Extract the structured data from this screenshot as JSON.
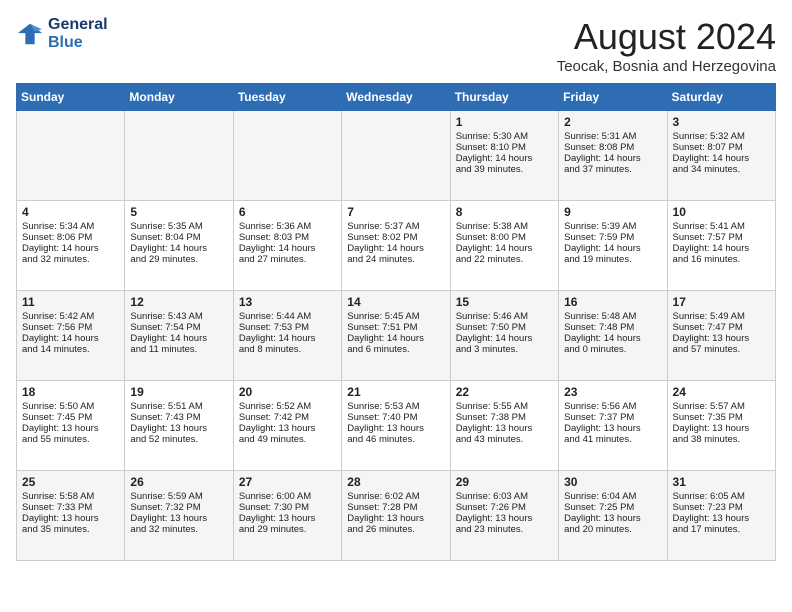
{
  "logo": {
    "line1": "General",
    "line2": "Blue"
  },
  "title": "August 2024",
  "location": "Teocak, Bosnia and Herzegovina",
  "headers": [
    "Sunday",
    "Monday",
    "Tuesday",
    "Wednesday",
    "Thursday",
    "Friday",
    "Saturday"
  ],
  "weeks": [
    [
      {
        "day": "",
        "content": ""
      },
      {
        "day": "",
        "content": ""
      },
      {
        "day": "",
        "content": ""
      },
      {
        "day": "",
        "content": ""
      },
      {
        "day": "1",
        "content": "Sunrise: 5:30 AM\nSunset: 8:10 PM\nDaylight: 14 hours\nand 39 minutes."
      },
      {
        "day": "2",
        "content": "Sunrise: 5:31 AM\nSunset: 8:08 PM\nDaylight: 14 hours\nand 37 minutes."
      },
      {
        "day": "3",
        "content": "Sunrise: 5:32 AM\nSunset: 8:07 PM\nDaylight: 14 hours\nand 34 minutes."
      }
    ],
    [
      {
        "day": "4",
        "content": "Sunrise: 5:34 AM\nSunset: 8:06 PM\nDaylight: 14 hours\nand 32 minutes."
      },
      {
        "day": "5",
        "content": "Sunrise: 5:35 AM\nSunset: 8:04 PM\nDaylight: 14 hours\nand 29 minutes."
      },
      {
        "day": "6",
        "content": "Sunrise: 5:36 AM\nSunset: 8:03 PM\nDaylight: 14 hours\nand 27 minutes."
      },
      {
        "day": "7",
        "content": "Sunrise: 5:37 AM\nSunset: 8:02 PM\nDaylight: 14 hours\nand 24 minutes."
      },
      {
        "day": "8",
        "content": "Sunrise: 5:38 AM\nSunset: 8:00 PM\nDaylight: 14 hours\nand 22 minutes."
      },
      {
        "day": "9",
        "content": "Sunrise: 5:39 AM\nSunset: 7:59 PM\nDaylight: 14 hours\nand 19 minutes."
      },
      {
        "day": "10",
        "content": "Sunrise: 5:41 AM\nSunset: 7:57 PM\nDaylight: 14 hours\nand 16 minutes."
      }
    ],
    [
      {
        "day": "11",
        "content": "Sunrise: 5:42 AM\nSunset: 7:56 PM\nDaylight: 14 hours\nand 14 minutes."
      },
      {
        "day": "12",
        "content": "Sunrise: 5:43 AM\nSunset: 7:54 PM\nDaylight: 14 hours\nand 11 minutes."
      },
      {
        "day": "13",
        "content": "Sunrise: 5:44 AM\nSunset: 7:53 PM\nDaylight: 14 hours\nand 8 minutes."
      },
      {
        "day": "14",
        "content": "Sunrise: 5:45 AM\nSunset: 7:51 PM\nDaylight: 14 hours\nand 6 minutes."
      },
      {
        "day": "15",
        "content": "Sunrise: 5:46 AM\nSunset: 7:50 PM\nDaylight: 14 hours\nand 3 minutes."
      },
      {
        "day": "16",
        "content": "Sunrise: 5:48 AM\nSunset: 7:48 PM\nDaylight: 14 hours\nand 0 minutes."
      },
      {
        "day": "17",
        "content": "Sunrise: 5:49 AM\nSunset: 7:47 PM\nDaylight: 13 hours\nand 57 minutes."
      }
    ],
    [
      {
        "day": "18",
        "content": "Sunrise: 5:50 AM\nSunset: 7:45 PM\nDaylight: 13 hours\nand 55 minutes."
      },
      {
        "day": "19",
        "content": "Sunrise: 5:51 AM\nSunset: 7:43 PM\nDaylight: 13 hours\nand 52 minutes."
      },
      {
        "day": "20",
        "content": "Sunrise: 5:52 AM\nSunset: 7:42 PM\nDaylight: 13 hours\nand 49 minutes."
      },
      {
        "day": "21",
        "content": "Sunrise: 5:53 AM\nSunset: 7:40 PM\nDaylight: 13 hours\nand 46 minutes."
      },
      {
        "day": "22",
        "content": "Sunrise: 5:55 AM\nSunset: 7:38 PM\nDaylight: 13 hours\nand 43 minutes."
      },
      {
        "day": "23",
        "content": "Sunrise: 5:56 AM\nSunset: 7:37 PM\nDaylight: 13 hours\nand 41 minutes."
      },
      {
        "day": "24",
        "content": "Sunrise: 5:57 AM\nSunset: 7:35 PM\nDaylight: 13 hours\nand 38 minutes."
      }
    ],
    [
      {
        "day": "25",
        "content": "Sunrise: 5:58 AM\nSunset: 7:33 PM\nDaylight: 13 hours\nand 35 minutes."
      },
      {
        "day": "26",
        "content": "Sunrise: 5:59 AM\nSunset: 7:32 PM\nDaylight: 13 hours\nand 32 minutes."
      },
      {
        "day": "27",
        "content": "Sunrise: 6:00 AM\nSunset: 7:30 PM\nDaylight: 13 hours\nand 29 minutes."
      },
      {
        "day": "28",
        "content": "Sunrise: 6:02 AM\nSunset: 7:28 PM\nDaylight: 13 hours\nand 26 minutes."
      },
      {
        "day": "29",
        "content": "Sunrise: 6:03 AM\nSunset: 7:26 PM\nDaylight: 13 hours\nand 23 minutes."
      },
      {
        "day": "30",
        "content": "Sunrise: 6:04 AM\nSunset: 7:25 PM\nDaylight: 13 hours\nand 20 minutes."
      },
      {
        "day": "31",
        "content": "Sunrise: 6:05 AM\nSunset: 7:23 PM\nDaylight: 13 hours\nand 17 minutes."
      }
    ]
  ]
}
